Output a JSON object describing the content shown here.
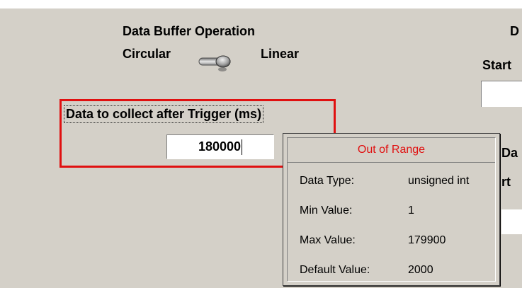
{
  "buffer": {
    "title": "Data Buffer Operation",
    "left_label": "Circular",
    "right_label": "Linear"
  },
  "trigger": {
    "label": "Data to collect after Trigger (ms)",
    "value": "180000"
  },
  "right_panel": {
    "fragment_1": "D",
    "fragment_2": "Start",
    "fragment_3": "Da",
    "fragment_4": "rt"
  },
  "tooltip": {
    "title": "Out of Range",
    "rows": [
      {
        "label": "Data Type:",
        "value": "unsigned int"
      },
      {
        "label": "Min Value:",
        "value": "1"
      },
      {
        "label": "Max Value:",
        "value": "179900"
      },
      {
        "label": "Default Value:",
        "value": "2000"
      }
    ]
  },
  "colors": {
    "panel_bg": "#d4d0c8",
    "error_red": "#e01010"
  },
  "icons": {
    "toggle": "toggle-switch-icon"
  }
}
